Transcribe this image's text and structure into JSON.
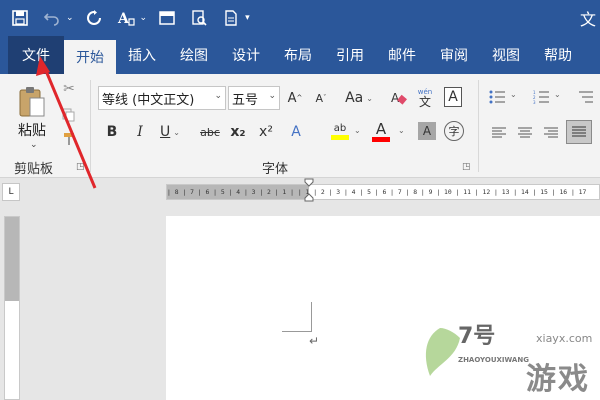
{
  "title_bar": {
    "quick_access": [
      "save-icon",
      "undo-icon",
      "redo-icon",
      "format-painter-icon",
      "window-icon",
      "print-preview-icon",
      "new-doc-icon"
    ],
    "right_text": "文"
  },
  "menu": {
    "file": "文件",
    "tabs": [
      "开始",
      "插入",
      "绘图",
      "设计",
      "布局",
      "引用",
      "邮件",
      "审阅",
      "视图",
      "帮助"
    ]
  },
  "clipboard": {
    "paste_label": "粘贴",
    "group_label": "剪贴板"
  },
  "font": {
    "font_name": "等线 (中文正文)",
    "font_size": "五号",
    "group_label": "字体",
    "case_label": "Aa",
    "phonetic_top": "wén",
    "phonetic_bottom": "文",
    "charborder_label": "A",
    "bold": "B",
    "italic": "I",
    "underline": "U",
    "strike": "abc",
    "subscript": "x₂",
    "superscript": "x²",
    "effects": "A",
    "highlight": "ab",
    "font_color": "A",
    "shading": "A",
    "enclose": "字",
    "grow": "A",
    "shrink": "A",
    "highlight_color": "#ffff00",
    "font_color_bar": "#ff0000"
  },
  "ruler": {
    "tab_selector": "L",
    "numbers": "| 8 | 7 | 6 | 5 | 4 | 3 | 2 | 1 |   | 1 | 2 | 3 | 4 | 5 | 6 | 7 | 8 | 9 | 10 | 11 | 12 | 13 | 14 | 15 | 16 | 17"
  },
  "document": {
    "paragraph_mark": "↵"
  },
  "watermark": {
    "logo": "7号",
    "site": "xiayx.com",
    "pinyin": "ZHAOYOUXIWANG",
    "game": "游戏"
  },
  "colors": {
    "brand": "#2b579a",
    "arrow": "#e0262b"
  }
}
